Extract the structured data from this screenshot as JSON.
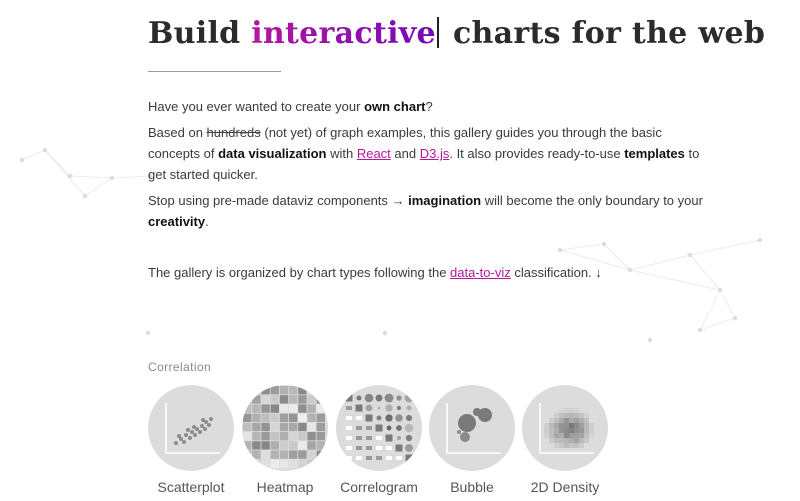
{
  "hero": {
    "title_start": "Build ",
    "title_accent": "interactive",
    "title_end": "charts for the web"
  },
  "intro": {
    "p1_text": "Have you ever wanted to create your ",
    "p1_bold": "own chart",
    "p1_end": "?",
    "p2_a": "Based on ",
    "p2_strike": "hundreds",
    "p2_b": " (not yet) of graph examples, this gallery guides you through the basic concepts of ",
    "p2_bold1": "data visualization",
    "p2_c": " with ",
    "p2_link1": "React",
    "p2_d": " and ",
    "p2_link2": "D3.js",
    "p2_e": ". It also provides ready-to-use ",
    "p2_bold2": "templates",
    "p2_f": " to get started quicker.",
    "p3_a": "Stop using pre-made dataviz components → ",
    "p3_bold1": "imagination",
    "p3_b": " will become the only boundary to your ",
    "p3_bold2": "creativity",
    "p3_c": ".",
    "p4_a": "The gallery is organized by chart types following the ",
    "p4_link": "data-to-viz",
    "p4_b": " classification. ↓"
  },
  "section": {
    "label": "Correlation",
    "items": [
      {
        "label": "Scatterplot",
        "icon": "scatterplot-icon"
      },
      {
        "label": "Heatmap",
        "icon": "heatmap-icon"
      },
      {
        "label": "Correlogram",
        "icon": "correlogram-icon"
      },
      {
        "label": "Bubble",
        "icon": "bubble-icon"
      },
      {
        "label": "2D Density",
        "icon": "density-2d-icon"
      }
    ]
  },
  "colors": {
    "accent_start": "#b5179e",
    "accent_end": "#7209b7",
    "link": "#b5179e",
    "thumb_bg": "#dcdcdc"
  }
}
